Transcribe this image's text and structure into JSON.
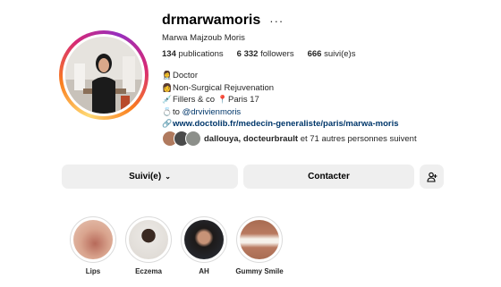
{
  "profile": {
    "username": "drmarwamoris",
    "full_name": "Marwa Majzoub Moris",
    "more_icon": "more-horizontal-icon"
  },
  "stats": [
    {
      "value": "134",
      "label": "publications"
    },
    {
      "value": "6 332",
      "label": "followers"
    },
    {
      "value": "666",
      "label": "suivi(e)s"
    }
  ],
  "bio": {
    "line1": "Doctor",
    "line2": "Non-Surgical Rejuvenation",
    "line3a": "Fillers & co",
    "line3b": "Paris 17",
    "line4_prefix": "to",
    "line4_mention": "@drvivienmoris",
    "link": "www.doctolib.fr/medecin-generaliste/paris/marwa-moris"
  },
  "followed_by": {
    "names": "dallouya, docteurbrault",
    "rest": "et 71 autres personnes suivent"
  },
  "actions": {
    "follow_label": "Suivi(e)",
    "contact_label": "Contacter",
    "add_icon": "add-person-icon"
  },
  "highlights": [
    {
      "label": "Lips"
    },
    {
      "label": "Eczema"
    },
    {
      "label": "AH"
    },
    {
      "label": "Gummy Smile"
    }
  ],
  "colors": {
    "link": "#00376b",
    "button_bg": "#efefef"
  }
}
